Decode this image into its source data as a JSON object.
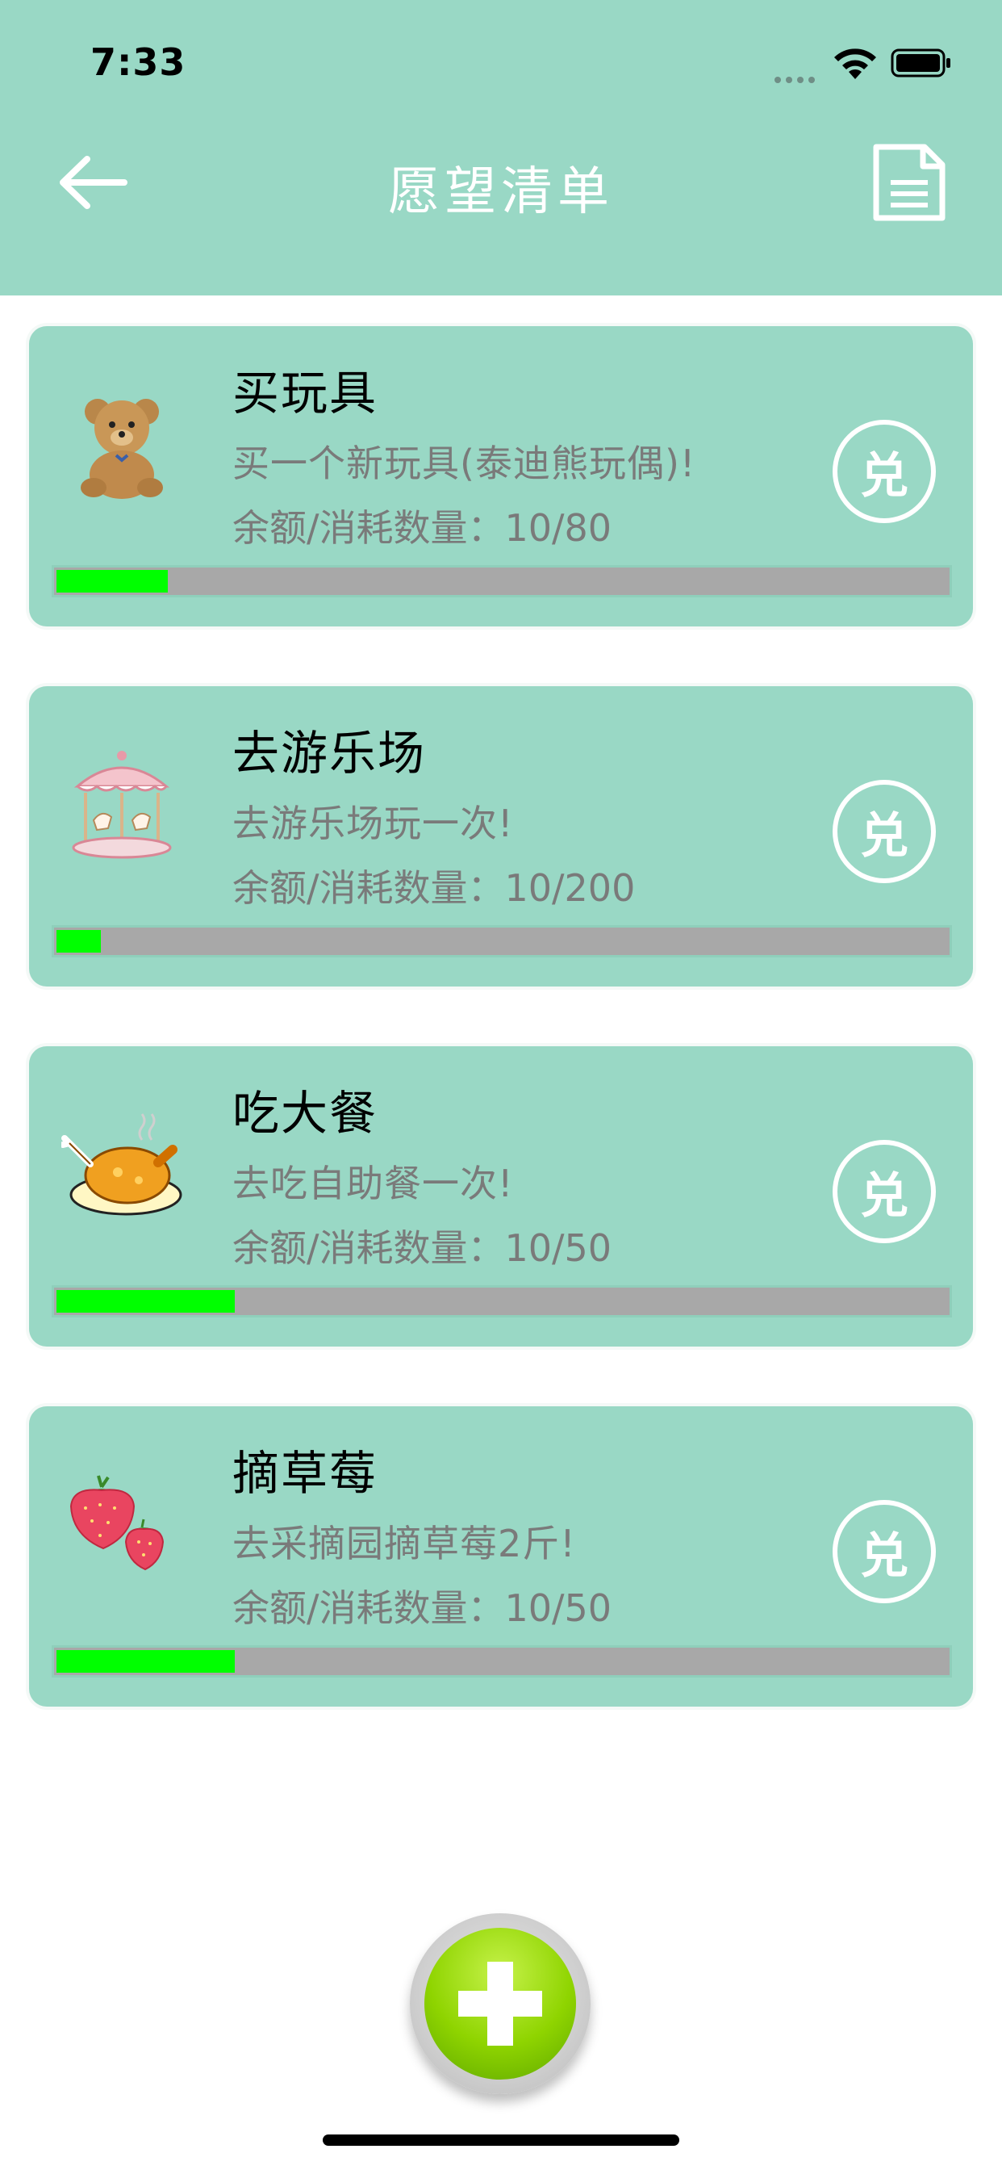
{
  "status_bar": {
    "time": "7:33"
  },
  "nav": {
    "title": "愿望清单",
    "back_icon": "arrow-left-icon",
    "doc_icon": "document-icon"
  },
  "colors": {
    "header": "#99d8c5",
    "card": "#99d8c5",
    "progress_fill": "#00ff00",
    "progress_track": "#a8a8a8"
  },
  "wishes": [
    {
      "title": "买玩具",
      "description": "买一个新玩具(泰迪熊玩偶)!",
      "balance_label": "余额/消耗数量：",
      "balance_value": "10/80",
      "progress": 0.125,
      "redeem_label": "兑",
      "icon": "teddy-bear-icon"
    },
    {
      "title": "去游乐场",
      "description": "去游乐场玩一次!",
      "balance_label": "余额/消耗数量：",
      "balance_value": "10/200",
      "progress": 0.05,
      "redeem_label": "兑",
      "icon": "carousel-icon"
    },
    {
      "title": "吃大餐",
      "description": "去吃自助餐一次!",
      "balance_label": "余额/消耗数量：",
      "balance_value": "10/50",
      "progress": 0.2,
      "redeem_label": "兑",
      "icon": "roast-chicken-icon"
    },
    {
      "title": "摘草莓",
      "description": "去采摘园摘草莓2斤!",
      "balance_label": "余额/消耗数量：",
      "balance_value": "10/50",
      "progress": 0.2,
      "redeem_label": "兑",
      "icon": "strawberry-icon"
    }
  ],
  "fab": {
    "icon": "plus-icon"
  }
}
